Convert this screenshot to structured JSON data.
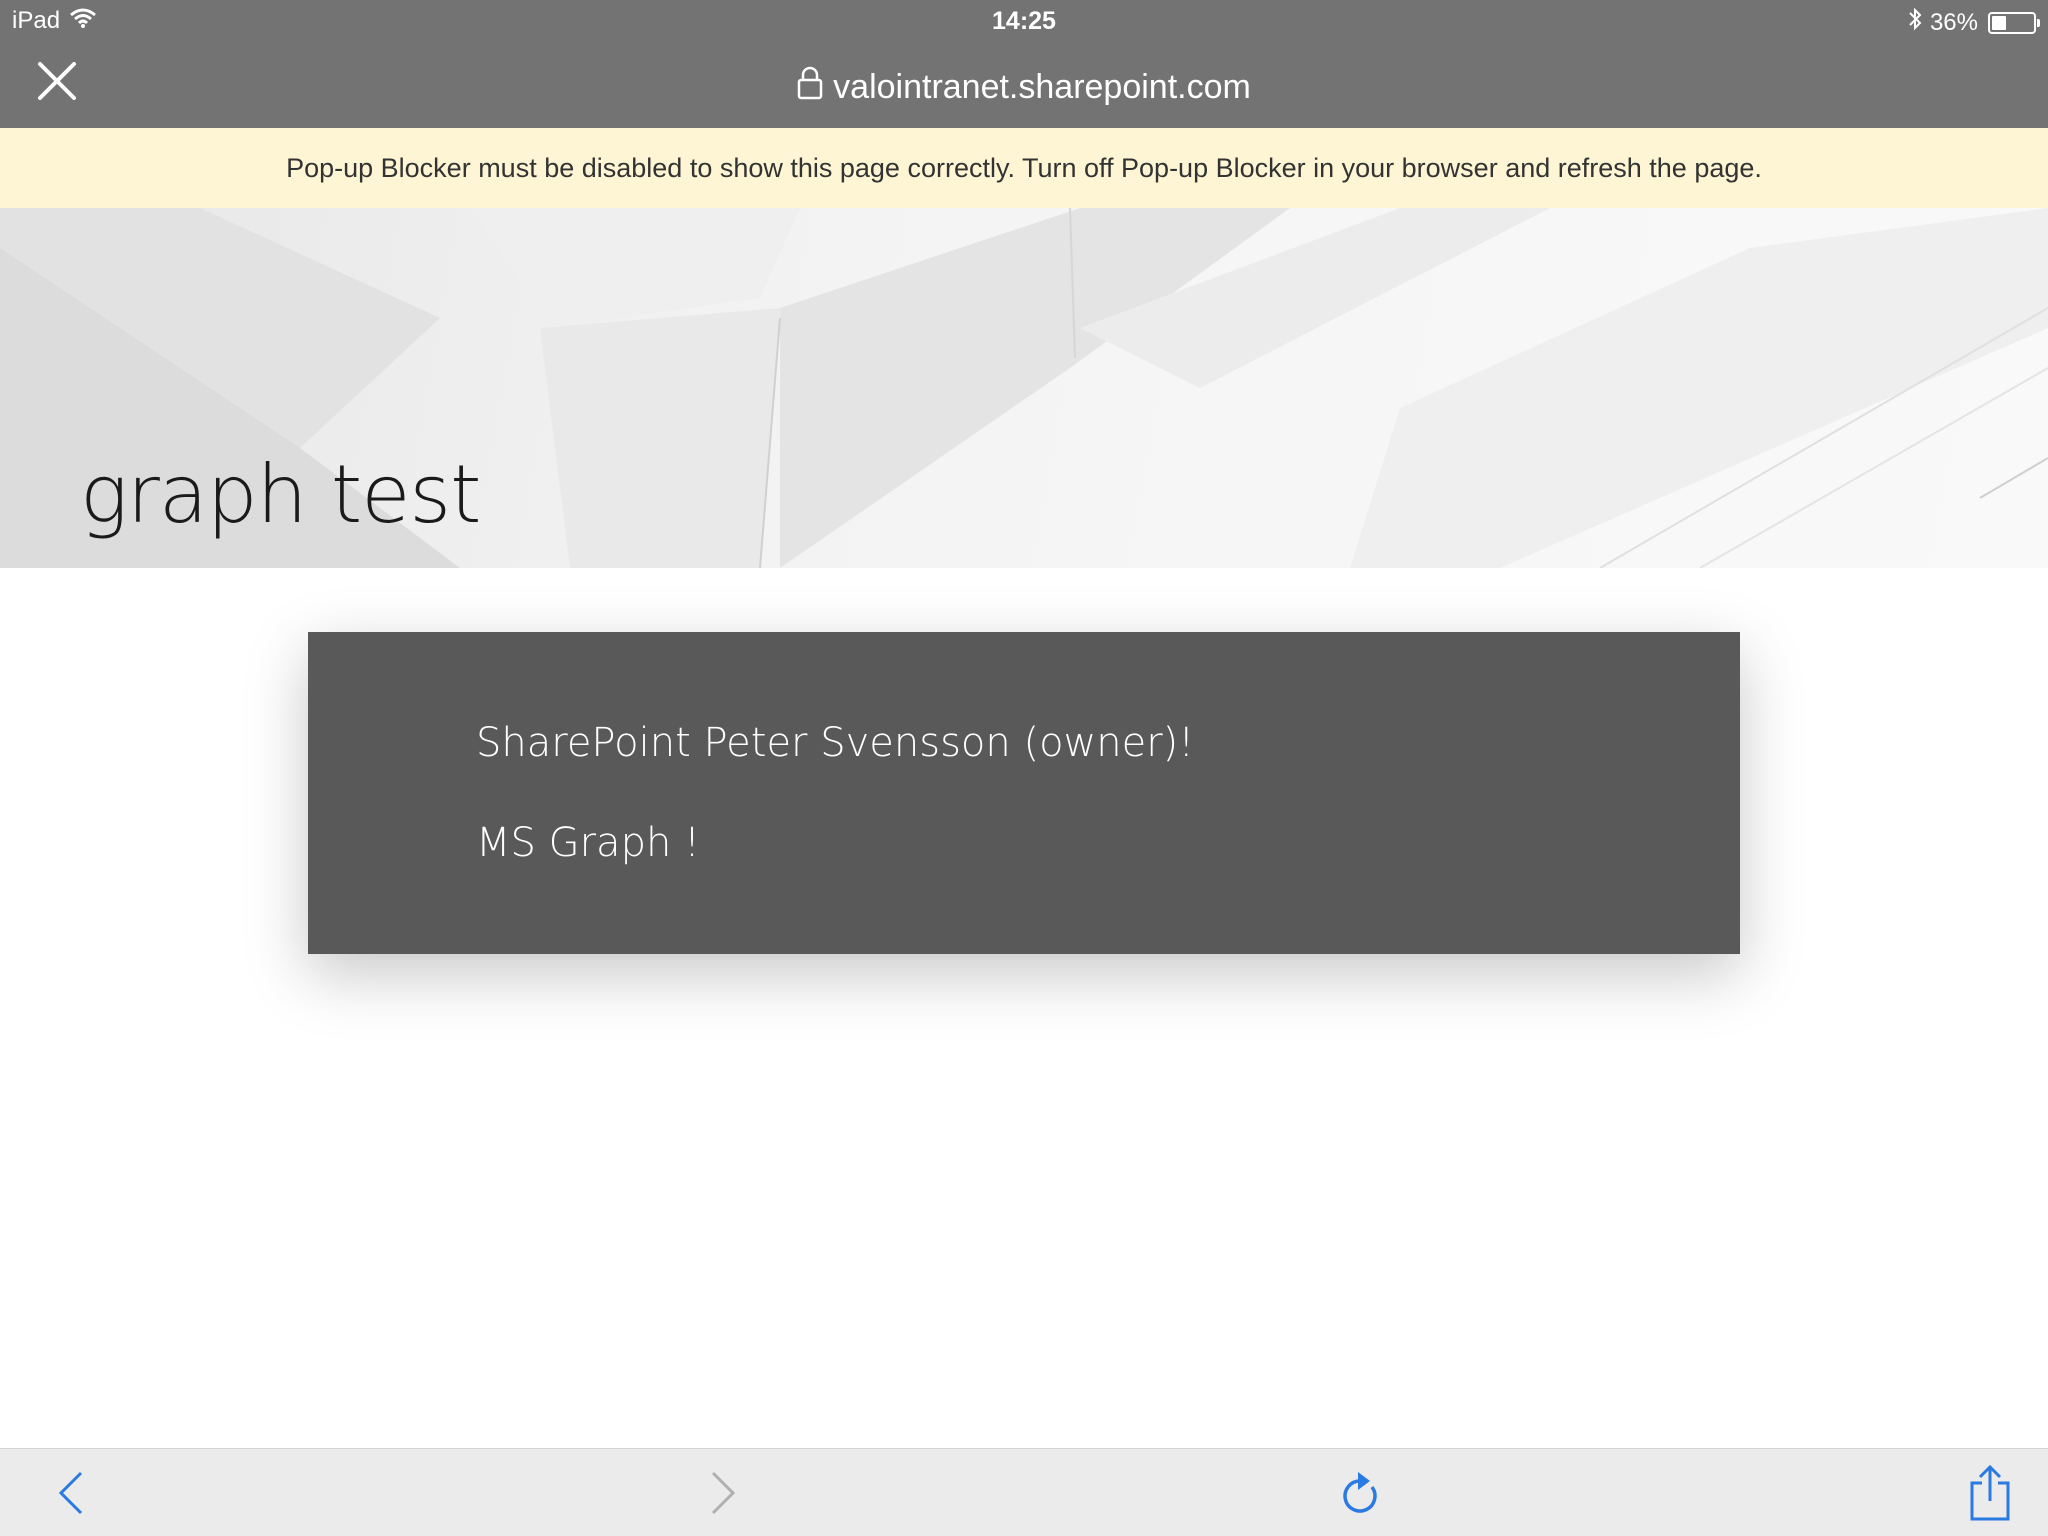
{
  "status_bar": {
    "device": "iPad",
    "time": "14:25",
    "battery_percent": "36%",
    "battery_level": 0.36
  },
  "url_bar": {
    "url": "valointranet.sharepoint.com"
  },
  "notice": {
    "text": "Pop-up Blocker must be disabled to show this page correctly. Turn off Pop-up Blocker in your browser and refresh the page."
  },
  "site": {
    "title": "graph test"
  },
  "webpart": {
    "line1": "SharePoint Peter Svensson (owner)!",
    "line2": "MS Graph !",
    "background_color": "#595959"
  },
  "toolbar": {
    "accent_color": "#2a7ae2",
    "icons": [
      "back-icon",
      "forward-icon",
      "reload-icon",
      "share-icon"
    ]
  }
}
